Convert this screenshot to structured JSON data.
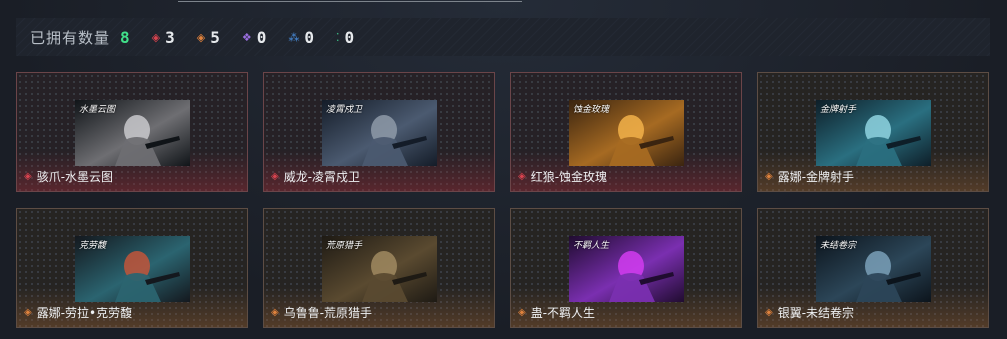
{
  "summary": {
    "title": "已拥有数量",
    "total": "8",
    "rarities": [
      {
        "icon": "red-diamond-icon",
        "color": "#d9434e",
        "glyph": "◈",
        "count": "3"
      },
      {
        "icon": "orange-diamond-icon",
        "color": "#e0823c",
        "glyph": "◈",
        "count": "5"
      },
      {
        "icon": "purple-clover-icon",
        "color": "#9a6fe0",
        "glyph": "❖",
        "count": "0"
      },
      {
        "icon": "blue-triangle-icon",
        "color": "#4a8fe0",
        "glyph": "⁂",
        "count": "0"
      },
      {
        "icon": "green-dots-icon",
        "color": "#3ec98a",
        "glyph": "⁚",
        "count": "0"
      }
    ]
  },
  "cards": [
    {
      "name": "骇爪-水墨云图",
      "rarity": "red",
      "thumb_text": "水墨云图",
      "thumb_colors": [
        "#101418",
        "#6e6e72",
        "#c9c9cc"
      ]
    },
    {
      "name": "威龙-凌霄戍卫",
      "rarity": "red",
      "thumb_text": "凌霄戍卫",
      "thumb_colors": [
        "#141c28",
        "#4b5a70",
        "#8e9aa8"
      ]
    },
    {
      "name": "红狼-蚀金玫瑰",
      "rarity": "red",
      "thumb_text": "蚀金玫瑰",
      "thumb_colors": [
        "#3a2410",
        "#a66a22",
        "#f2b24a"
      ]
    },
    {
      "name": "露娜-金牌射手",
      "rarity": "orange",
      "thumb_text": "金牌射手",
      "thumb_colors": [
        "#0e1e28",
        "#2a6f80",
        "#8fd4e0"
      ]
    },
    {
      "name": "露娜-劳拉•克劳馥",
      "rarity": "orange",
      "thumb_text": "克劳馥",
      "thumb_colors": [
        "#14181e",
        "#2b6470",
        "#c2553a"
      ]
    },
    {
      "name": "乌鲁鲁-荒原猎手",
      "rarity": "orange",
      "thumb_text": "荒原猎手",
      "thumb_colors": [
        "#1e1a14",
        "#5a4a30",
        "#a08a60"
      ]
    },
    {
      "name": "蛊-不羁人生",
      "rarity": "orange",
      "thumb_text": "不羁人生",
      "thumb_colors": [
        "#200c30",
        "#7a2fb0",
        "#d23cf0"
      ]
    },
    {
      "name": "银翼-未结卷宗",
      "rarity": "orange",
      "thumb_text": "未结卷宗",
      "thumb_colors": [
        "#0c141c",
        "#2c4658",
        "#7aa0b8"
      ]
    }
  ]
}
